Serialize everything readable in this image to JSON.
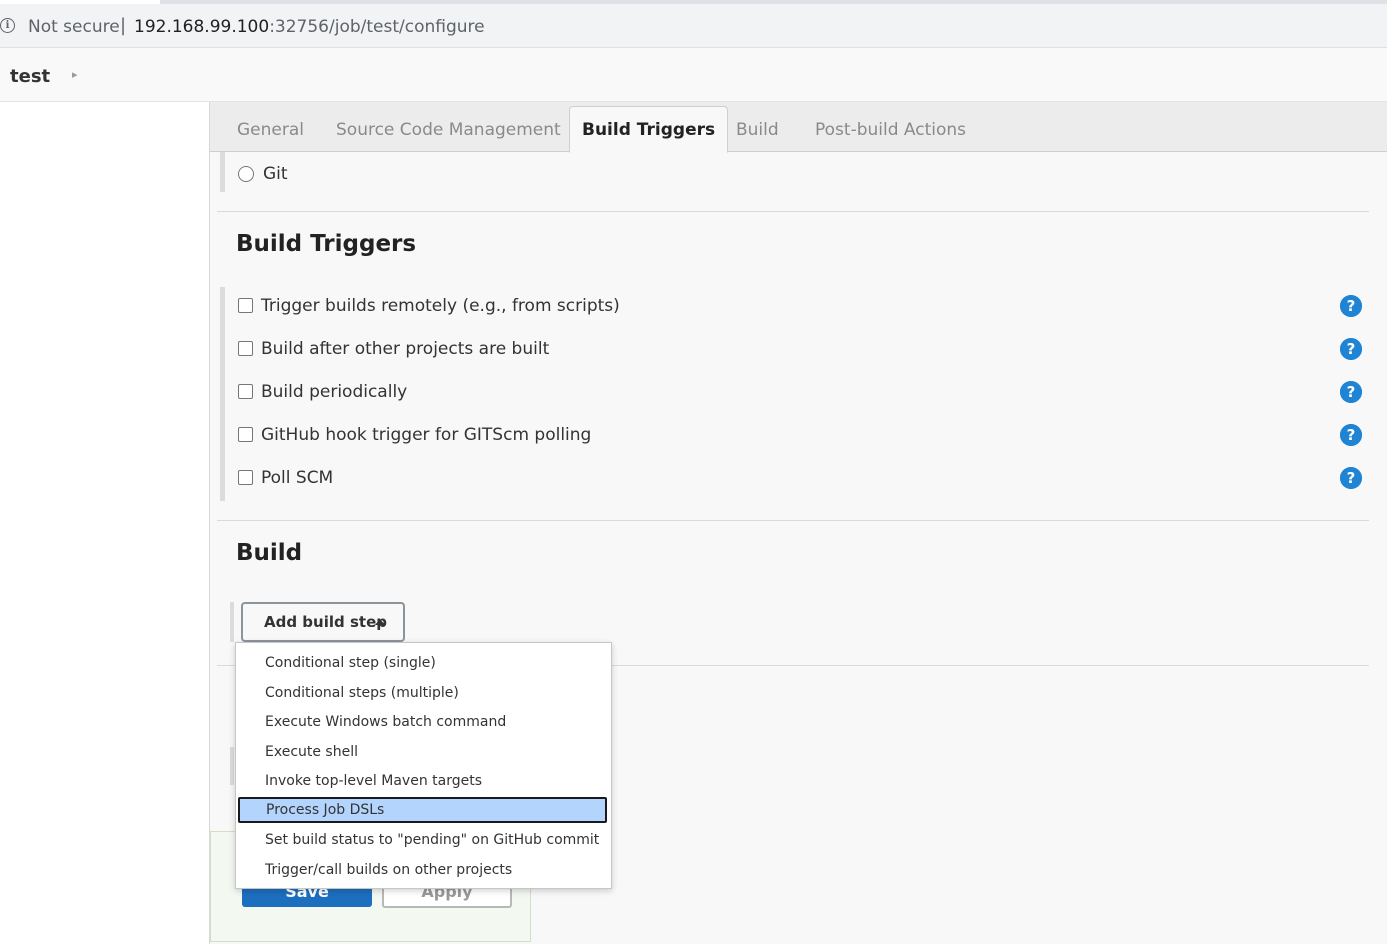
{
  "browser": {
    "security_label": "Not secure",
    "separator": "|",
    "url_host": "192.168.99.100",
    "url_rest": ":32756/job/test/configure"
  },
  "breadcrumb": {
    "job": "test",
    "arrow": "▸"
  },
  "tabs": [
    {
      "label": "General",
      "active": false
    },
    {
      "label": "Source Code Management",
      "active": false
    },
    {
      "label": "Build Triggers",
      "active": true
    },
    {
      "label": "Build",
      "active": false
    },
    {
      "label": "Post-build Actions",
      "active": false
    }
  ],
  "scm": {
    "git_label": "Git"
  },
  "build_triggers": {
    "title": "Build Triggers",
    "options": [
      {
        "label": "Trigger builds remotely (e.g., from scripts)",
        "checked": false
      },
      {
        "label": "Build after other projects are built",
        "checked": false
      },
      {
        "label": "Build periodically",
        "checked": false
      },
      {
        "label": "GitHub hook trigger for GITScm polling",
        "checked": false
      },
      {
        "label": "Poll SCM",
        "checked": false
      }
    ],
    "help_glyph": "?"
  },
  "build": {
    "title": "Build",
    "add_step_label": "Add build step",
    "menu_items": [
      {
        "label": "Conditional step (single)",
        "selected": false
      },
      {
        "label": "Conditional steps (multiple)",
        "selected": false
      },
      {
        "label": "Execute Windows batch command",
        "selected": false
      },
      {
        "label": "Execute shell",
        "selected": false
      },
      {
        "label": "Invoke top-level Maven targets",
        "selected": false
      },
      {
        "label": "Process Job DSLs",
        "selected": true
      },
      {
        "label": "Set build status to \"pending\" on GitHub commit",
        "selected": false
      },
      {
        "label": "Trigger/call builds on other projects",
        "selected": false
      }
    ]
  },
  "footer": {
    "save_label": "Save",
    "apply_label": "Apply"
  },
  "colors": {
    "help_blue": "#1e84d3",
    "menu_highlight": "#b3d4fc",
    "save_blue": "#1c6fbf"
  }
}
